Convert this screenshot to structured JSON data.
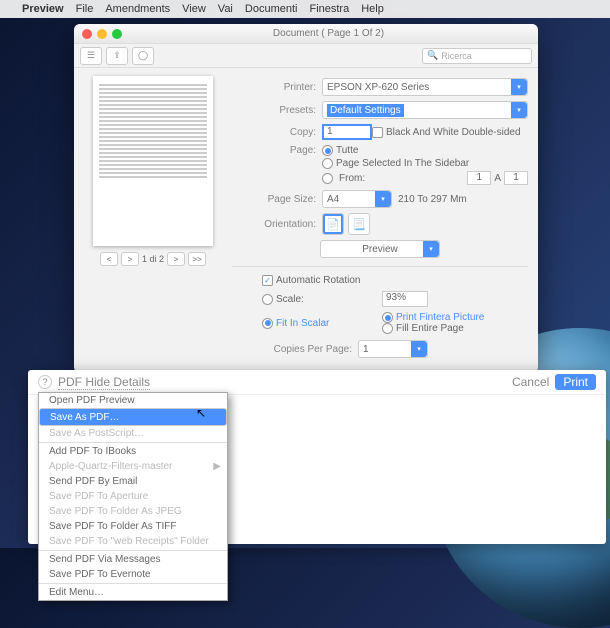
{
  "menubar": {
    "appname": "Preview",
    "items": [
      "File",
      "Amendments",
      "View",
      "Vai",
      "Documenti",
      "Finestra",
      "Help"
    ]
  },
  "window": {
    "title": "Document ( Page 1 Of 2)",
    "search_placeholder": "Ricerca"
  },
  "pager": {
    "label": "1 di 2",
    "prev": "<",
    "next": ">",
    "last": ">>"
  },
  "print": {
    "printer_label": "Printer:",
    "printer_value": "EPSON XP-620 Series",
    "presets_label": "Presets:",
    "presets_value": "Default Settings",
    "copy_label": "Copy:",
    "copy_value": "1",
    "bw_label": "Black And White Double-sided",
    "page_label": "Page:",
    "radio_all": "Tutte",
    "radio_sel": "Page Selected In The Sidebar",
    "radio_from": "From:",
    "range_a": "1",
    "range_sep": "A",
    "range_b": "1",
    "size_label": "Page Size:",
    "size_value": "A4",
    "size_dim": "210 To 297 Mm",
    "orient_label": "Orientation:",
    "midselect": "Preview",
    "auto_rot": "Automatic Rotation",
    "scale_label": "Scale:",
    "scale_value": "93%",
    "fit_label": "Fit In Scalar",
    "print_fint": "Print Fintera Picture",
    "fill_entire": "Fill Entire Page",
    "cpp_label": "Copies Per Page:",
    "cpp_value": "1"
  },
  "lowerbar": {
    "pdf": "PDF",
    "hide": "Hide Details",
    "cancel": "Cancel",
    "print": "Print"
  },
  "dropdown": {
    "items": [
      {
        "label": "Open PDF Preview",
        "sep": false
      },
      {
        "label": "Save As PDF…",
        "sep": false,
        "selected": true
      },
      {
        "label": "Save As PostScript…",
        "sep": true,
        "faded": true
      },
      {
        "label": "Add PDF To IBooks",
        "sep": false
      },
      {
        "label": "Apple-Quartz-Filters-master",
        "sep": false,
        "faded": true,
        "submenu": true
      },
      {
        "label": "Send PDF By Email",
        "sep": false
      },
      {
        "label": "Save PDF To Aperture",
        "sep": false,
        "faded": true
      },
      {
        "label": "Save PDF To Folder As JPEG",
        "sep": false,
        "faded": true
      },
      {
        "label": "Save PDF To Folder As TIFF",
        "sep": false
      },
      {
        "label": "Save PDF To \"web Receipts\" Folder",
        "sep": true,
        "faded": true
      },
      {
        "label": "Send PDF Via Messages",
        "sep": false
      },
      {
        "label": "Save PDF To Evernote",
        "sep": true
      },
      {
        "label": "Edit Menu…",
        "sep": false
      }
    ]
  }
}
